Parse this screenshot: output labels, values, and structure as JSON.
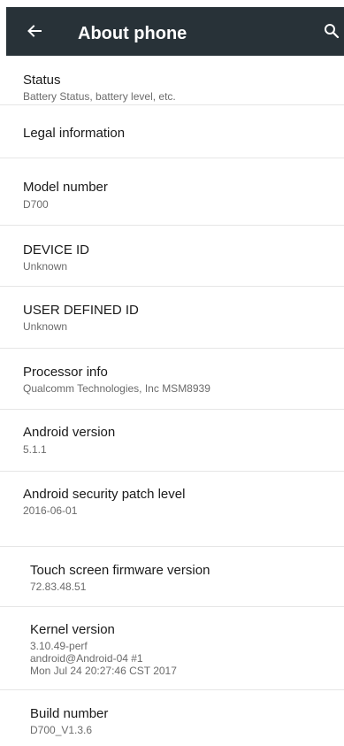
{
  "toolbar": {
    "title": "About phone",
    "back_icon": "arrow-left-icon",
    "search_icon": "search-icon",
    "background": "#283238"
  },
  "items": [
    {
      "title": "Status",
      "summary": "Battery Status, battery level, etc."
    },
    {
      "title": "Legal information"
    },
    {
      "title": "Model number",
      "summary": "D700"
    },
    {
      "title": "DEVICE ID",
      "summary": "Unknown"
    },
    {
      "title": "USER DEFINED ID",
      "summary": "Unknown"
    },
    {
      "title": "Processor info",
      "summary": "Qualcomm Technologies, Inc MSM8939"
    },
    {
      "title": "Android version",
      "summary": "5.1.1"
    },
    {
      "title": "Android security patch level",
      "summary": "2016-06-01"
    },
    {
      "title": "Touch screen firmware version",
      "summary": "72.83.48.51"
    },
    {
      "title": "Kernel version",
      "summary_lines": [
        "3.10.49-perf",
        "android@Android-04 #1",
        "Mon Jul 24 20:27:46 CST 2017"
      ]
    },
    {
      "title": "Build number",
      "summary": "D700_V1.3.6"
    }
  ]
}
